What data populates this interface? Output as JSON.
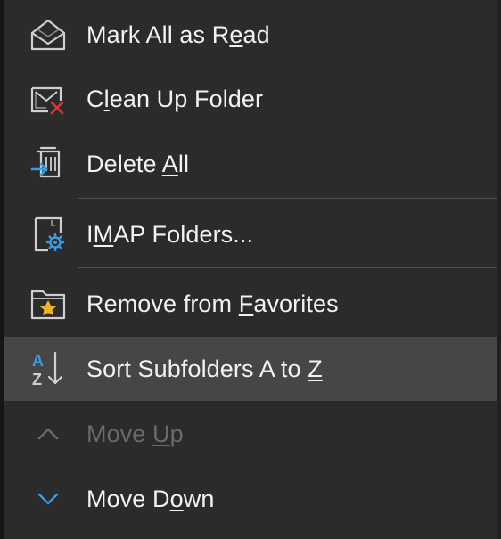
{
  "menu": {
    "items": [
      {
        "id": "mark-all-read",
        "pre": "Mark All as R",
        "ul": "e",
        "post": "ad",
        "icon": "envelope-open-icon",
        "enabled": true,
        "highlighted": false
      },
      {
        "id": "clean-up-folder",
        "pre": "C",
        "ul": "l",
        "post": "ean Up Folder",
        "icon": "clean-up-folder-icon",
        "enabled": true,
        "highlighted": false
      },
      {
        "id": "delete-all",
        "pre": "Delete ",
        "ul": "A",
        "post": "ll",
        "icon": "delete-all-icon",
        "enabled": true,
        "highlighted": false
      },
      {
        "id": "imap-folders",
        "pre": "I",
        "ul": "M",
        "post": "AP Folders...",
        "icon": "imap-folder-settings-icon",
        "enabled": true,
        "highlighted": false
      },
      {
        "id": "remove-favorites",
        "pre": "Remove from ",
        "ul": "F",
        "post": "avorites",
        "icon": "folder-star-icon",
        "enabled": true,
        "highlighted": false
      },
      {
        "id": "sort-subfolders",
        "pre": "Sort Subfolders A to ",
        "ul": "Z",
        "post": "",
        "icon": "sort-a-to-z-icon",
        "enabled": true,
        "highlighted": true
      },
      {
        "id": "move-up",
        "pre": "Move ",
        "ul": "U",
        "post": "p",
        "icon": "chevron-up-icon",
        "enabled": false,
        "highlighted": false
      },
      {
        "id": "move-down",
        "pre": "Move D",
        "ul": "o",
        "post": "wn",
        "icon": "chevron-down-icon",
        "enabled": true,
        "highlighted": false
      }
    ]
  },
  "colors": {
    "menu_background": "#2b2b2b",
    "highlight_background": "#464646",
    "text": "#f2f2f2",
    "disabled_text": "#6a6a6a",
    "accent_blue": "#3a9de0",
    "danger_red": "#e0383c",
    "star_gold": "#f2b51c"
  }
}
